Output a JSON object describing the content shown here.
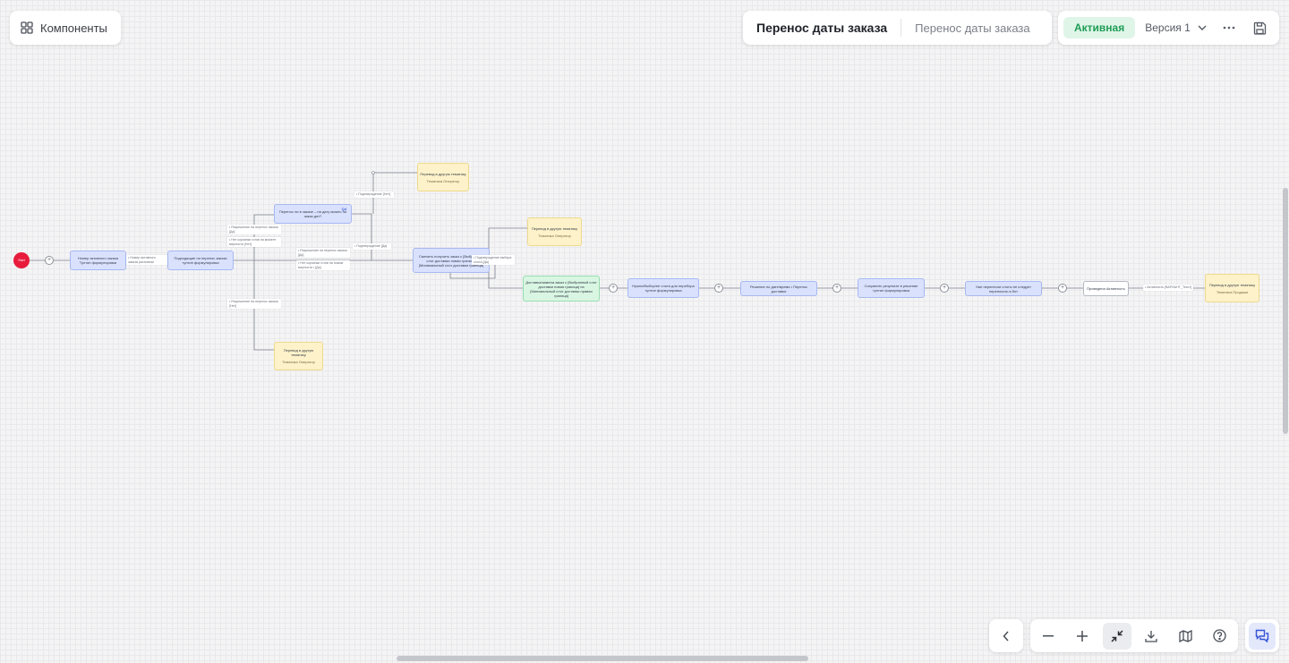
{
  "toolbar": {
    "components_label": "Компоненты"
  },
  "header": {
    "title": "Перенос даты заказа",
    "subtitle": "Перенос даты заказа"
  },
  "status": {
    "badge": "Активная",
    "version_label": "Версия 1"
  },
  "flow": {
    "start_label": "Start",
    "nodes": {
      "n1": "Номер активного заказа Тултип формулировки",
      "n2": "Подходящие ли перенос заказа тултип формулировка",
      "n3_badge": "Q4",
      "n3": "Перенос ли в заказе – на дату можно ли заказ дат?",
      "n4": "Перевод в другую тематику",
      "n4_sub": "Тематика Оператор",
      "n5": "Сменить получить заказ с [Выбранный слот доставки новая граница] [Минимальный слот доставки граница]",
      "n6": "Перевод в другую тематику",
      "n6_sub": "Тематика Оператор",
      "n7": "Доставка/замена заказ с [Выбранный слот доставки новая граница] на [Минимальный слот доставки правая граница]",
      "n8": "Нужно/Выбор/ее слота для перебора тултип формулировка",
      "n9": "Решение по дате/время • Перенос доставки",
      "n10": "Сохранить результат в решение тултип формулировка",
      "n11": "Уже перенесли слоты не следует переносить в бот",
      "n12": "Проведена Активность",
      "n13": "Перевод в другую тематику",
      "n13_sub": "Тематика Продажи",
      "n14": "Перевод в другую тематику",
      "n14_sub": "Тематика Оператор"
    },
    "conditions": {
      "c1": "• Номер активного заказа распознан",
      "c2a": "• Разрешение на перенос заказа [Да]",
      "c2b": "• Нет корзинки готов на момент мерности [Нет]",
      "c3": "• Подтверждение [Нет]",
      "c4": "• Подтверждение [Да]",
      "c5a": "• Разрешение на перенос заказа [Да]",
      "c5b": "• Нет корзинки готов на новом мерности • [Да]",
      "c6": "• Подтверждение выбора слота [Да]",
      "c7": "• Разрешение на перенос заказа [Нет]",
      "c8": "• Активность  [ВАРИАНТ_Текст]"
    }
  },
  "controls": {
    "zoom_tools": [
      "zoom-out",
      "zoom-in",
      "fit-view",
      "download",
      "map",
      "help"
    ]
  }
}
